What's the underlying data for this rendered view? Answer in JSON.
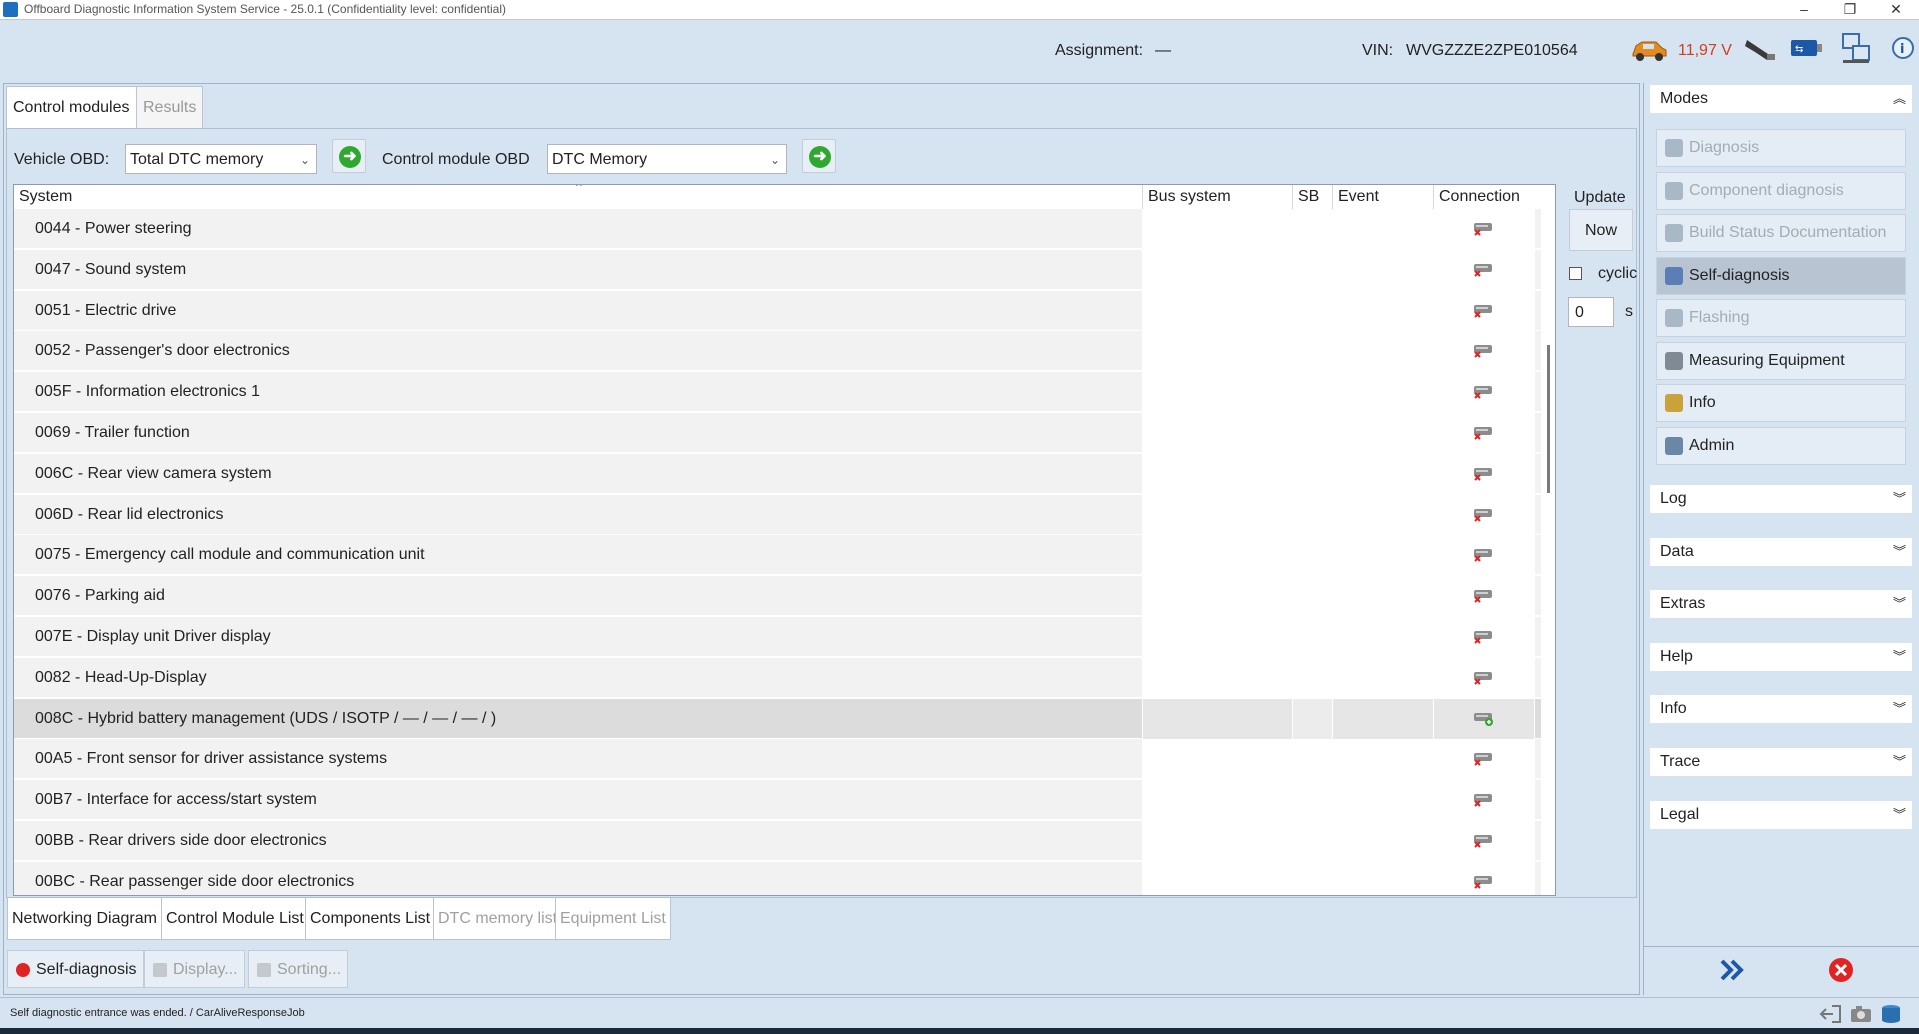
{
  "window": {
    "title": "Offboard Diagnostic Information System Service - 25.0.1 (Confidentiality level: confidential)",
    "minimize": "–",
    "maximize": "❐",
    "close": "✕"
  },
  "header": {
    "assignment_label": "Assignment:",
    "assignment_value": "—",
    "vin_label": "VIN:",
    "vin_value": "WVGZZZE2ZPE010564",
    "voltage": "11,97 V"
  },
  "top_tabs": [
    "Control modules",
    "Results"
  ],
  "filters": {
    "vehicle_obd_label": "Vehicle OBD:",
    "vehicle_obd_value": "Total DTC memory",
    "control_module_obd_label": "Control module OBD",
    "control_module_obd_value": "DTC Memory"
  },
  "table": {
    "columns": [
      "System",
      "Bus system",
      "SB",
      "Event",
      "Connection"
    ],
    "rows": [
      {
        "system": "0044 - Power steering",
        "connected": false
      },
      {
        "system": "0047 - Sound system",
        "connected": false
      },
      {
        "system": "0051 - Electric drive",
        "connected": false
      },
      {
        "system": "0052 - Passenger's door electronics",
        "connected": false
      },
      {
        "system": "005F - Information electronics 1",
        "connected": false
      },
      {
        "system": "0069 - Trailer function",
        "connected": false
      },
      {
        "system": "006C - Rear view camera system",
        "connected": false
      },
      {
        "system": "006D - Rear lid electronics",
        "connected": false
      },
      {
        "system": "0075 - Emergency call module and communication unit",
        "connected": false
      },
      {
        "system": "0076 - Parking aid",
        "connected": false
      },
      {
        "system": "007E - Display unit Driver display",
        "connected": false
      },
      {
        "system": "0082 - Head-Up-Display",
        "connected": false
      },
      {
        "system": "008C - Hybrid battery management  (UDS / ISOTP / — / — / — /  )",
        "connected": true,
        "selected": true
      },
      {
        "system": "00A5 - Front sensor for driver assistance systems",
        "connected": false
      },
      {
        "system": "00B7 - Interface for access/start system",
        "connected": false
      },
      {
        "system": "00BB - Rear drivers side door electronics",
        "connected": false
      },
      {
        "system": "00BC - Rear passenger side door electronics",
        "connected": false
      }
    ]
  },
  "update": {
    "label": "Update",
    "now_button": "Now",
    "cyclic_label": "cyclic",
    "cyclic_checked": false,
    "seconds_value": "0",
    "seconds_unit": "s"
  },
  "bottom_tabs": [
    {
      "label": "Networking Diagram",
      "enabled": true
    },
    {
      "label": "Control Module List",
      "enabled": true
    },
    {
      "label": "Components List",
      "enabled": true
    },
    {
      "label": "DTC memory list",
      "enabled": false
    },
    {
      "label": "Equipment List",
      "enabled": false
    }
  ],
  "actions": [
    {
      "label": "Self-diagnosis",
      "enabled": true
    },
    {
      "label": "Display...",
      "enabled": false
    },
    {
      "label": "Sorting...",
      "enabled": false
    }
  ],
  "sidebar": {
    "modes_label": "Modes",
    "modes": [
      {
        "label": "Diagnosis",
        "enabled": false,
        "active": false
      },
      {
        "label": "Component diagnosis",
        "enabled": false,
        "active": false
      },
      {
        "label": "Build Status Documentation",
        "enabled": false,
        "active": false
      },
      {
        "label": "Self-diagnosis",
        "enabled": true,
        "active": true
      },
      {
        "label": "Flashing",
        "enabled": false,
        "active": false
      },
      {
        "label": "Measuring Equipment",
        "enabled": true,
        "active": false
      },
      {
        "label": "Info",
        "enabled": true,
        "active": false
      },
      {
        "label": "Admin",
        "enabled": true,
        "active": false
      }
    ],
    "sections": [
      "Log",
      "Data",
      "Extras",
      "Help",
      "Info",
      "Trace",
      "Legal"
    ]
  },
  "status_bar": {
    "message": "Self diagnostic entrance was ended. / CarAliveResponseJob"
  },
  "colors": {
    "background": "#d6e3f1",
    "voltage": "#d43c1e",
    "accent_blue": "#1f6fbf",
    "go_green": "#2fa82f",
    "error_red": "#e02424"
  }
}
